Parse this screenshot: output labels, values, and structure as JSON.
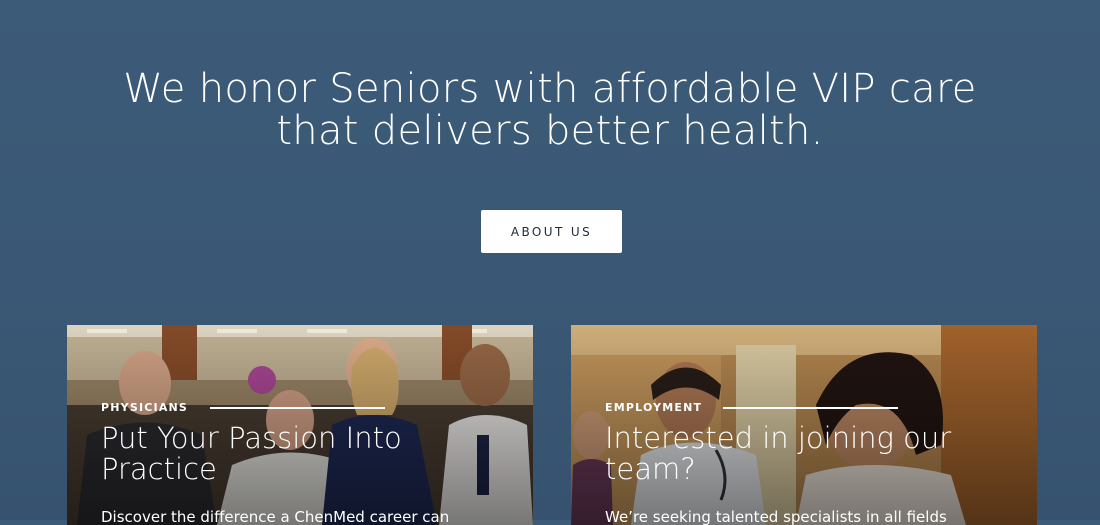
{
  "hero": {
    "title_line1": "We honor Seniors with affordable VIP care",
    "title_line2": "that delivers better health.",
    "button_label": "ABOUT US"
  },
  "cards": [
    {
      "eyebrow": "PHYSICIANS",
      "heading_line1": "Put Your Passion Into",
      "heading_line2": "Practice",
      "body": "Discover the difference a ChenMed career can"
    },
    {
      "eyebrow": "EMPLOYMENT",
      "heading_line1": "Interested in joining our",
      "heading_line2": "team?",
      "body": "We’re seeking talented specialists in all fields"
    }
  ],
  "colors": {
    "background": "#3a5875",
    "button_bg": "#ffffff",
    "button_text": "#1e2a36",
    "text": "#ffffff"
  }
}
